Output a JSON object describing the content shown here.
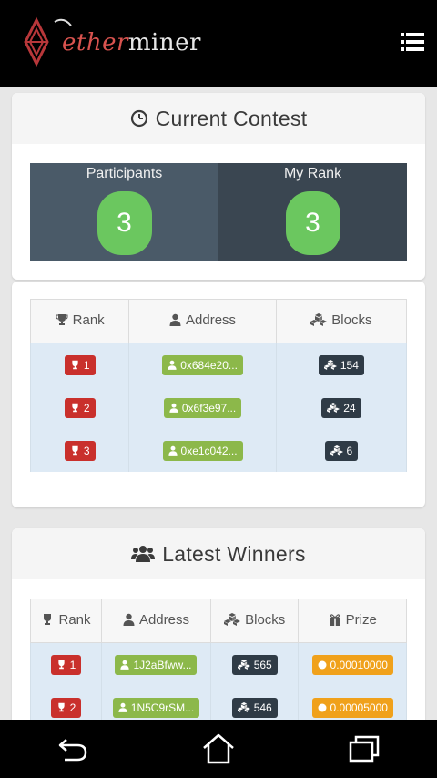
{
  "app": {
    "logo_part1": "ether",
    "logo_part2": "miner"
  },
  "current_contest": {
    "title": "Current Contest",
    "participants_label": "Participants",
    "participants_value": "3",
    "my_rank_label": "My Rank",
    "my_rank_value": "3",
    "columns": [
      "Rank",
      "Address",
      "Blocks"
    ],
    "rows": [
      {
        "rank": "1",
        "address": "0x684e20...",
        "blocks": "154"
      },
      {
        "rank": "2",
        "address": "0x6f3e97...",
        "blocks": "24"
      },
      {
        "rank": "3",
        "address": "0xe1c042...",
        "blocks": "6"
      }
    ]
  },
  "latest_winners": {
    "title": "Latest Winners",
    "columns": [
      "Rank",
      "Address",
      "Blocks",
      "Prize"
    ],
    "rows": [
      {
        "rank": "1",
        "address": "1J2aBfww...",
        "blocks": "565",
        "prize": "0.00010000"
      },
      {
        "rank": "2",
        "address": "1N5C9rSM...",
        "blocks": "546",
        "prize": "0.00005000"
      }
    ]
  },
  "colors": {
    "topbar": "#000000",
    "accent_red": "#c9302c",
    "accent_green": "#8cb84a",
    "rank_value_green": "#6bc75f",
    "stat_dark": "#3a4651",
    "prize_orange": "#f0a11b"
  }
}
